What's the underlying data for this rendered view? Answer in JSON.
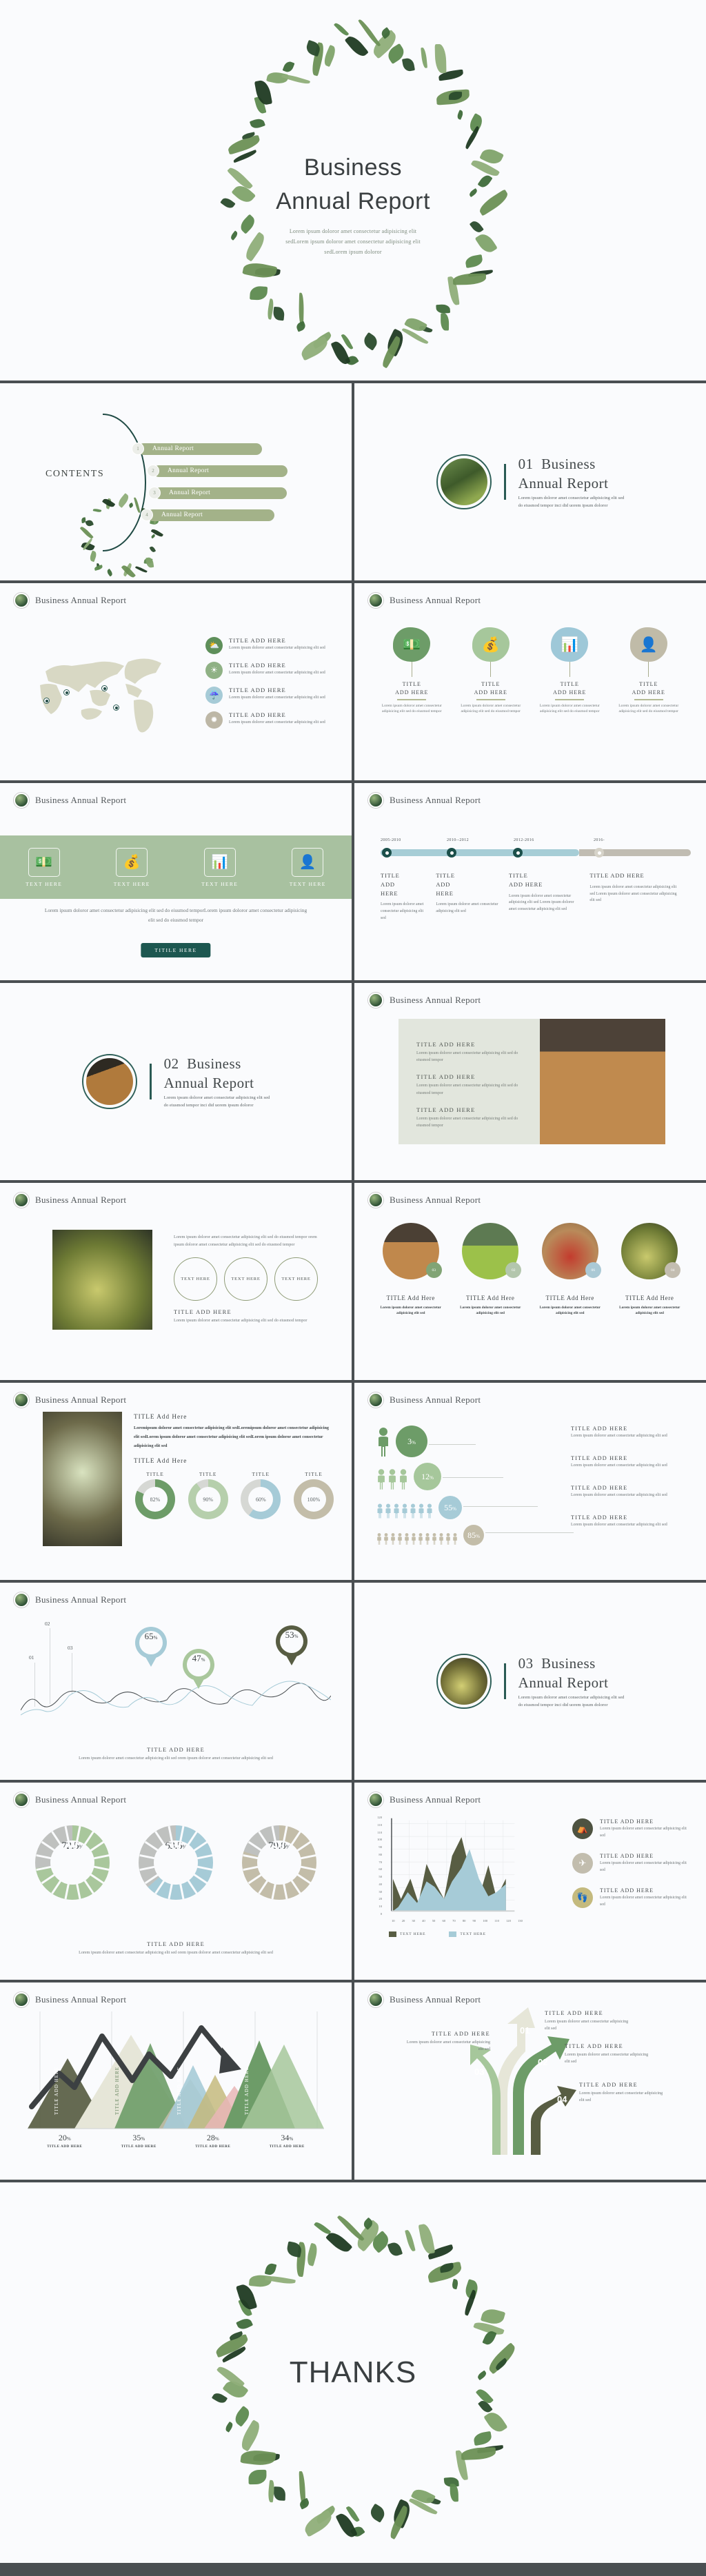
{
  "brand": {
    "accent_dark_green": "#1d5750",
    "accent_green": "#6f9d6a",
    "accent_light_green": "#a8c1a0",
    "accent_blue": "#a6cdd6",
    "accent_tan": "#c3bda9",
    "slide_bg": "#fafbfd",
    "page_bg": "#4a4f52"
  },
  "cover": {
    "title_line1": "Business",
    "title_line2": "Annual Report",
    "subtitle_line1": "Lorem ipsum doloror amet consectetur  adipisicing  elit",
    "subtitle_line2": "sedLorem  ipsum  doloror  amet consectetur   adipisicing  elit",
    "subtitle_line3": "sedLorem  ipsum  doloror"
  },
  "contents": {
    "label": "CONTENTS",
    "items": [
      {
        "num": "1",
        "label": "Annual Report"
      },
      {
        "num": "2",
        "label": "Annual Report"
      },
      {
        "num": "3",
        "label": "Annual Report"
      },
      {
        "num": "4",
        "label": "Annual Report"
      }
    ]
  },
  "sections": [
    {
      "number": "01",
      "title_line1": "Business",
      "title_line2": "Annual Report",
      "desc_line1": "Lorem ipsum doloror amet consectetur adipisicing elit sed",
      "desc_line2": "do eiusmod tempor inci did uorem ipsum doloror"
    },
    {
      "number": "02",
      "title_line1": "Business",
      "title_line2": "Annual Report",
      "desc_line1": "Lorem ipsum doloror amet consectetur adipisicing elit sed",
      "desc_line2": "do eiusmod tempor inci did uorem ipsum doloror"
    },
    {
      "number": "03",
      "title_line1": "Business",
      "title_line2": "Annual Report",
      "desc_line1": "Lorem ipsum doloror amet consectetur adipisicing elit sed",
      "desc_line2": "do eiusmod tempor inci did uorem ipsum doloror"
    }
  ],
  "header_title": "Business Annual Report",
  "map_slide": {
    "items": [
      {
        "icon": "sun-cloud-icon",
        "glyph": "⛅",
        "color": "#5e8f5a",
        "title": "TITLE   ADD   HERE",
        "desc": "Lorem  ipsum  doloror  amet consectetur  adipisicing  elit sed"
      },
      {
        "icon": "sun-icon",
        "glyph": "☀",
        "color": "#8fb185",
        "title": "TITLE   ADD   HERE",
        "desc": "Lorem  ipsum  doloror  amet consectetur  adipisicing  elit sed"
      },
      {
        "icon": "rain-cloud-icon",
        "glyph": "☔",
        "color": "#a6cbd7",
        "title": "TITLE   ADD   HERE",
        "desc": "Lorem  ipsum  doloror  amet consectetur  adipisicing  elit sed"
      },
      {
        "icon": "sunburst-icon",
        "glyph": "✹",
        "color": "#bdb7a6",
        "title": "TITLE   ADD   HERE",
        "desc": "Lorem  ipsum  doloror  amet consectetur  adipisicing  elit sed"
      }
    ]
  },
  "blob_slide": {
    "items": [
      {
        "icon": "cash-icon",
        "glyph": "💵",
        "color": "#6d9c68",
        "title_line1": "TITLE",
        "title_line2": "ADD   HERE",
        "desc": "Lorem  ipsum  doloror  amet consectetur adipisicing  elit sed do eiusmod  tempor"
      },
      {
        "icon": "money-bag-icon",
        "glyph": "💰",
        "color": "#a6c79b",
        "title_line1": "TITLE",
        "title_line2": "ADD   HERE",
        "desc": "Lorem  ipsum  doloror  amet consectetur adipisicing  elit sed do eiusmod  tempor"
      },
      {
        "icon": "bar-chart-growth-icon",
        "glyph": "📊",
        "color": "#9ec8d8",
        "title_line1": "TITLE",
        "title_line2": "ADD   HERE",
        "desc": "Lorem  ipsum  doloror  amet consectetur adipisicing  elit sed do eiusmod  tempor"
      },
      {
        "icon": "finance-person-icon",
        "glyph": "👤",
        "color": "#c0bba8",
        "title_line1": "TITLE",
        "title_line2": "ADD   HERE",
        "desc": "Lorem  ipsum  doloror  amet consectetur adipisicing  elit sed do eiusmod  tempor"
      }
    ]
  },
  "band_slide": {
    "items": [
      {
        "icon": "cash-icon",
        "glyph": "💵",
        "label": "TEXT HERE"
      },
      {
        "icon": "money-bag-icon",
        "glyph": "💰",
        "label": "TEXT HERE"
      },
      {
        "icon": "bar-chart-growth-icon",
        "glyph": "📊",
        "label": "TEXT HERE"
      },
      {
        "icon": "finance-person-icon",
        "glyph": "👤",
        "label": "TEXT HERE"
      }
    ],
    "paragraph": "Lorem  ipsum  doloror  amet  consectetur   adipisicing   elit  sed  do  eiusmod  temporLorem  ipsum  doloror  amet  consectetur   adipisicing  elit  sed  do  eiusmod  tempor",
    "button_label": "TITILE  HERE"
  },
  "timeline_slide": {
    "years": [
      "2005-2010",
      "2010--2012",
      "2012-2016",
      "2016-"
    ],
    "items": [
      {
        "title": "TITLE\nADD\nHERE",
        "desc": "Lorem  ipsum  doloror  amet consectetur  adipisicing  elit sed"
      },
      {
        "title": "TITLE\nADD\nHERE",
        "desc": "Lorem  ipsum  doloror  amet consectetur  adipisicing  elit sed"
      },
      {
        "title": "TITLE\nADD   HERE",
        "desc": "Lorem  ipsum  doloror amet consectetur adipisicing  elit sed Lorem  ipsum  doloror amet consectetur adipisicing  elit sed"
      },
      {
        "title": "TITLE   ADD   HERE",
        "desc": "Lorem  ipsum  doloror  amet consectetur adipisicing  elit sed Lorem  ipsum  doloror  amet consectetur adipisicing  elit sed"
      }
    ]
  },
  "text_image_slide": {
    "blocks": [
      {
        "title": "TITLE   ADD   HERE",
        "desc": "Lorem  ipsum  doloror  amet consectetur adipisicing  elit sed do eiusmod  tempor"
      },
      {
        "title": "TITLE   ADD   HERE",
        "desc": "Lorem  ipsum  doloror  amet consectetur adipisicing  elit sed do eiusmod  tempor"
      },
      {
        "title": "TITLE   ADD   HERE",
        "desc": "Lorem  ipsum  doloror  amet consectetur adipisicing  elit sed do eiusmod  tempor"
      }
    ]
  },
  "image_circles_slide": {
    "paragraph": "Lorem  ipsum  doloror  amet consectetur  adipisicing  elit sed do eiusmod  tempor   orem  ipsum  doloror  amet consectetur  adipisicing  elit sed do eiusmod  tempor",
    "circles": [
      "TEXT  HERE",
      "TEXT  HERE",
      "TEXT  HERE"
    ],
    "title": "TITLE   ADD   HERE",
    "desc": "Lorem  ipsum  doloror  amet consectetur  adipisicing elit sed do eiusmod  tempor"
  },
  "photo_circles_slide": {
    "items": [
      {
        "badge": "03",
        "badge_color": "#81a475",
        "title": "TITLE  Add Here",
        "desc": "Lorem ipsum doloror amet consectetur adipisicing elit sed"
      },
      {
        "badge": "02",
        "badge_color": "#b3c6ad",
        "title": "TITLE  Add Here",
        "desc": "Lorem ipsum doloror amet consectetur adipisicing elit sed"
      },
      {
        "badge": "06",
        "badge_color": "#aac9d5",
        "title": "TITLE  Add Here",
        "desc": "Lorem ipsum doloror amet consectetur adipisicing elit sed"
      },
      {
        "badge": "04",
        "badge_color": "#c3bdb0",
        "title": "TITLE  Add Here",
        "desc": "Lorem ipsum doloror amet consectetur adipisicing elit sed"
      }
    ]
  },
  "donut_slide": {
    "title1": "TITLE  Add Here",
    "paragraph": "Loremipsum doloror amet consectetur adipisicing elit sedLoremipsum doloror amet consectetur adipisicing elit sedLorem ipsum doloror amet consectetur adipisicing elit sedLorem ipsum doloror amet consectetur adipisicing elit sed",
    "title2": "TITLE  Add Here",
    "chart_data": {
      "type": "pie",
      "title": "TITLE  Add Here",
      "categories": [
        "TITLE",
        "TITLE",
        "TITLE",
        "TITLE"
      ],
      "values": [
        82,
        90,
        60,
        100
      ],
      "labels": [
        "82%",
        "90%",
        "60%",
        "100%"
      ],
      "colors": [
        "#6d9c68",
        "#b6cfac",
        "#a6cbd7",
        "#c3bda9"
      ],
      "track_color": "#d6d8d4"
    }
  },
  "people_slide": {
    "chart_data": {
      "type": "bar",
      "categories": [
        "TITLE   ADD   HERE",
        "TITLE   ADD   HERE",
        "TITLE   ADD   HERE",
        "TITLE   ADD   HERE"
      ],
      "values": [
        3,
        12,
        55,
        85
      ],
      "labels": [
        "3%",
        "12%",
        "55%",
        "85%"
      ],
      "icon_counts": [
        1,
        3,
        7,
        12
      ],
      "colors": [
        "#6d9c68",
        "#a6c79b",
        "#a6cbd7",
        "#c3bda9"
      ],
      "title": "",
      "xlabel": "",
      "ylabel": ""
    },
    "items": [
      {
        "title": "TITLE   ADD   HERE",
        "desc": "Lorem  ipsum  doloror  amet consectetur  adipisicing  elit sed"
      },
      {
        "title": "TITLE   ADD   HERE",
        "desc": "Lorem  ipsum  doloror  amet consectetur  adipisicing  elit sed"
      },
      {
        "title": "TITLE   ADD   HERE",
        "desc": "Lorem  ipsum  doloror  amet consectetur  adipisicing  elit sed"
      },
      {
        "title": "TITLE   ADD   HERE",
        "desc": "Lorem  ipsum  doloror  amet consectetur  adipisicing  elit sed"
      }
    ]
  },
  "wave_slide": {
    "markers": [
      "01",
      "02",
      "03"
    ],
    "chart_data": {
      "type": "line",
      "title": "TITLE   ADD   HERE",
      "annotations": [
        {
          "label": "65%",
          "value": 65,
          "color": "#a6cbd7"
        },
        {
          "label": "47%",
          "value": 47,
          "color": "#a9c79c"
        },
        {
          "label": "53%",
          "value": 53,
          "color": "#585d43"
        }
      ],
      "series": [
        {
          "name": "series-dark",
          "color": "#4a4f52"
        },
        {
          "name": "series-light",
          "color": "#a6cbd7"
        }
      ]
    },
    "caption_title": "TITLE   ADD   HERE",
    "caption_desc": "Lorem  ipsum  doloror  amet consectetur  adipisicing  elit sed   orem  ipsum  doloror  amet consectetur  adipisicing  elit sed"
  },
  "segment_donuts_slide": {
    "chart_data": {
      "type": "pie",
      "values": [
        72.5,
        63.5,
        79.8
      ],
      "labels": [
        "72.5",
        "63.5",
        "79.8"
      ],
      "unit": "%",
      "colors": [
        "#a9c79c",
        "#a6cbd7",
        "#c3bda9"
      ],
      "track_color": "#bfc1bf",
      "title": "TITLE   ADD   HERE"
    },
    "caption_title": "TITLE   ADD   HERE",
    "caption_desc": "Lorem  ipsum  doloror  amet consectetur  adipisicing  elit sed   orem  ipsum  doloror  amet consectetur  adipisicing  elit sed"
  },
  "area_chart_slide": {
    "chart_data": {
      "type": "area",
      "y_ticks": [
        "120",
        "110",
        "110",
        "100",
        "90",
        "80",
        "70",
        "60",
        "50",
        "40",
        "30",
        "20",
        "10",
        "0"
      ],
      "x_ticks": [
        "10",
        "20",
        "30",
        "40",
        "50",
        "60",
        "70",
        "80",
        "90",
        "100",
        "110",
        "120",
        "130"
      ],
      "ylim": [
        0,
        120
      ],
      "grid": true,
      "legend": [
        "TEXT  HERE",
        "TEXT  HERE"
      ],
      "series": [
        {
          "name": "TEXT  HERE",
          "color": "#585d43",
          "values": [
            40,
            20,
            40,
            12,
            60,
            32,
            17,
            48,
            62,
            78,
            40,
            22,
            58,
            20,
            40
          ]
        },
        {
          "name": "TEXT  HERE",
          "color": "#a6cbd7",
          "values": [
            2,
            10,
            28,
            12,
            32,
            26,
            16,
            30,
            45,
            62,
            40,
            20,
            25,
            18,
            32
          ]
        }
      ]
    },
    "items": [
      {
        "icon": "tent-icon",
        "glyph": "⛺",
        "color": "#4e5341",
        "title": "TITLE   ADD   HERE",
        "desc": "Lorem  ipsum  doloror  amet consectetur  adipisicing  elit sed"
      },
      {
        "icon": "airplane-icon",
        "glyph": "✈",
        "color": "#c2bdae",
        "title": "TITLE   ADD   HERE",
        "desc": "Lorem  ipsum  doloror  amet consectetur  adipisicing  elit sed"
      },
      {
        "icon": "footprints-icon",
        "glyph": "👣",
        "color": "#c4ba7e",
        "title": "TITLE   ADD   HERE",
        "desc": "Lorem  ipsum  doloror  amet consectetur  adipisicing  elit sed"
      }
    ]
  },
  "mountain_slide": {
    "chart_data": {
      "type": "area",
      "categories": [
        "TITLE ADD HERE",
        "TITLE ADD HERE",
        "TITLE ADD HERE",
        "TITLE ADD HERE"
      ],
      "values": [
        20,
        35,
        28,
        34
      ],
      "labels": [
        "20",
        "35",
        "28",
        "34"
      ],
      "unit": "%",
      "inner_labels": [
        "TITLE  ADD  HERE",
        "TITLE  ADD  HERE",
        "TITLE  ADD  HERE",
        "TITLE  ADD  HERE"
      ],
      "colors": [
        "#585d43",
        "#e6e6d8",
        "#a6cbd7",
        "#6d9c68"
      ],
      "title": ""
    }
  },
  "arrows_slide": {
    "items": [
      {
        "num": "01",
        "color": "#e6e6d8",
        "title": "TITLE   ADD   HERE",
        "desc": "Lorem  ipsum  doloror  amet consectetur  adipisicing  elit sed"
      },
      {
        "num": "02",
        "color": "#6d9c68",
        "title": "TITLE   ADD   HERE",
        "desc": "Lorem  ipsum  doloror  amet consectetur  adipisicing  elit sed"
      },
      {
        "num": "03",
        "color": "#a6c79b",
        "title": "TITLE   ADD   HERE",
        "desc": "Lorem  ipsum  doloror  amet consectetur  adipisicing  elit sed"
      },
      {
        "num": "04",
        "color": "#585d43",
        "title": "TITLE   ADD   HERE",
        "desc": "Lorem  ipsum  doloror  amet consectetur  adipisicing  elit sed"
      }
    ]
  },
  "thanks": {
    "title": "THANKS"
  }
}
